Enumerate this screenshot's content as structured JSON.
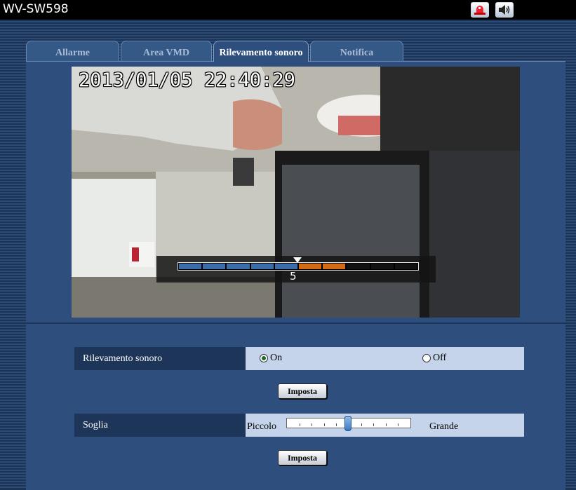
{
  "app": {
    "title": "WV-SW598"
  },
  "header": {
    "icons": [
      "alarm-icon",
      "audio-icon"
    ]
  },
  "tabs": [
    {
      "label": "Allarme",
      "active": false
    },
    {
      "label": "Area VMD",
      "active": false
    },
    {
      "label": "Rilevamento sonoro",
      "active": true
    },
    {
      "label": "Notifica",
      "active": false
    }
  ],
  "camera": {
    "timestamp": "2013/01/05 22:40:29",
    "audio_level": {
      "segments": 10,
      "filled_blue": 5,
      "filled_orange": 2,
      "threshold": "5"
    }
  },
  "settings": {
    "rilevamento": {
      "label": "Rilevamento sonoro",
      "on_label": "On",
      "off_label": "Off",
      "selected": "On"
    },
    "imposta_1": "Imposta",
    "soglia": {
      "label": "Soglia",
      "min_label": "Piccolo",
      "max_label": "Grande",
      "value": 5,
      "steps": 9
    },
    "imposta_2": "Imposta"
  },
  "colors": {
    "level_blue": "#3b6ea8",
    "level_orange": "#d26a16",
    "panel": "#2e4f7d",
    "row_label_bg": "#1d3558",
    "row_value_bg": "#c5d4ea"
  }
}
